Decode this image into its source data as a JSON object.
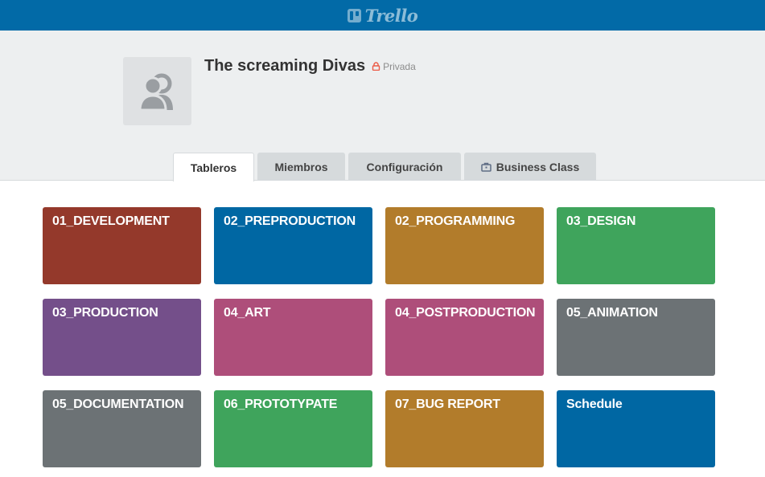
{
  "app": {
    "logo_text": "Trello",
    "colors": {
      "topbar": "#026aa7",
      "header_bg": "#edeff0"
    }
  },
  "team": {
    "name": "The screaming Divas",
    "privacy_label": "Privada",
    "avatar_icon": "team-members-icon",
    "privacy_icon": "lock-icon"
  },
  "tabs": [
    {
      "label": "Tableros",
      "active": true
    },
    {
      "label": "Miembros",
      "active": false
    },
    {
      "label": "Configuración",
      "active": false
    },
    {
      "label": "Business Class",
      "active": false,
      "icon": "briefcase-icon"
    }
  ],
  "boards": [
    {
      "title": "01_DEVELOPMENT",
      "color": "#94392b"
    },
    {
      "title": "02_PREPRODUCTION",
      "color": "#0067a3"
    },
    {
      "title": "02_PROGRAMMING",
      "color": "#b27c2b"
    },
    {
      "title": "03_DESIGN",
      "color": "#3fa45c"
    },
    {
      "title": "03_PRODUCTION",
      "color": "#744f8a"
    },
    {
      "title": "04_ART",
      "color": "#ae4e7a"
    },
    {
      "title": "04_POSTPRODUCTION",
      "color": "#ae4e7a"
    },
    {
      "title": "05_ANIMATION",
      "color": "#6c7275"
    },
    {
      "title": "05_DOCUMENTATION",
      "color": "#6c7275"
    },
    {
      "title": "06_PROTOTYPATE",
      "color": "#3fa45c"
    },
    {
      "title": "07_BUG REPORT",
      "color": "#b27c2b"
    },
    {
      "title": "Schedule",
      "color": "#0067a3"
    }
  ]
}
